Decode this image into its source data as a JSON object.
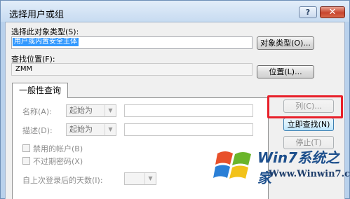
{
  "window": {
    "title": "选择用户或组",
    "help_glyph": "?",
    "close_glyph": "✕"
  },
  "object_type": {
    "label": "选择此对象类型(S):",
    "value": "用户或内置安全主体",
    "button": "对象类型(O)..."
  },
  "location": {
    "label": "查找位置(F):",
    "value": "ZMM",
    "button": "位置(L)..."
  },
  "tabs": [
    {
      "label": "一般性查询"
    }
  ],
  "query": {
    "name_label": "名称(A):",
    "name_mode": "起始为",
    "desc_label": "描述(D):",
    "desc_mode": "起始为",
    "disabled_accounts": "禁用的帐户(B)",
    "non_expiring_pw": "不过期密码(X)",
    "days_since_login": "自上次登录后的天数(I):"
  },
  "side_buttons": {
    "columns": "列(C)...",
    "find_now": "立即查找(N)",
    "stop": "停止(T)"
  },
  "watermark": {
    "title": "Win7系统之家",
    "url": "Www.Winwin7.com"
  },
  "colors": {
    "highlight": "#e8202a",
    "selection": "#3399ff",
    "close_button": "#c8452e"
  }
}
